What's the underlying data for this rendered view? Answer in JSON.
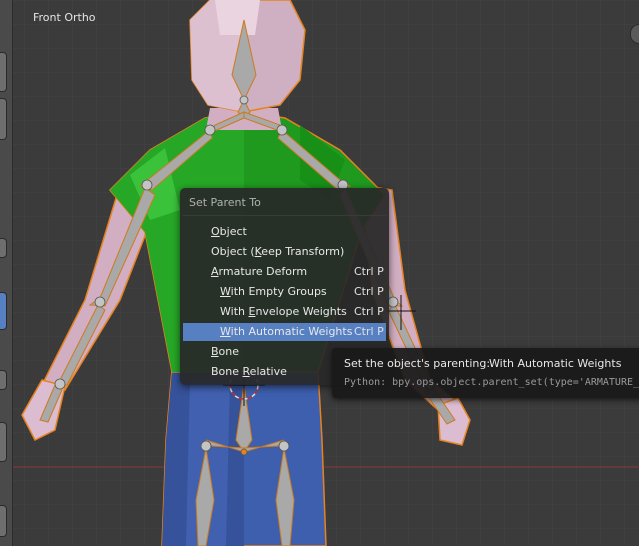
{
  "viewport": {
    "label": "Front Ortho"
  },
  "menu": {
    "title": "Set Parent To",
    "items": [
      {
        "label": "Object",
        "shortcut": "",
        "underline": "O",
        "indent": false,
        "active": false
      },
      {
        "label": "Object (Keep Transform)",
        "shortcut": "",
        "underline": "K",
        "indent": false,
        "active": false
      },
      {
        "label": "Armature Deform",
        "shortcut": "Ctrl P",
        "underline": "A",
        "indent": false,
        "active": false
      },
      {
        "label": "With Empty Groups",
        "shortcut": "Ctrl P",
        "underline": "W",
        "indent": true,
        "active": false
      },
      {
        "label": "With Envelope Weights",
        "shortcut": "Ctrl P",
        "underline": "E",
        "indent": true,
        "active": false
      },
      {
        "label": "With Automatic Weights",
        "shortcut": "Ctrl P",
        "underline": "W",
        "indent": true,
        "active": true
      },
      {
        "label": "Bone",
        "shortcut": "",
        "underline": "B",
        "indent": false,
        "active": false
      },
      {
        "label": "Bone Relative",
        "shortcut": "",
        "underline": "R",
        "indent": false,
        "active": false
      }
    ]
  },
  "tooltip": {
    "description": "Set the object's parenting:",
    "value": "With Automatic Weights",
    "python": "Python: bpy.ops.object.parent_set(type='ARMATURE_"
  },
  "colors": {
    "viewport_bg": "#3b3b3b",
    "menu_highlight": "#5680c2",
    "shirt_green": "#1f9a1f",
    "skin": "#d9b8cc",
    "pants_blue": "#3d5fae",
    "bone_gray": "#a7a7a7",
    "selection_outline": "#e8821e"
  }
}
